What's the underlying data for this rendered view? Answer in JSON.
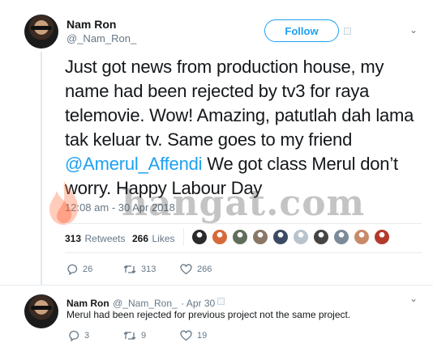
{
  "main_tweet": {
    "name": "Nam Ron",
    "handle": "@_Nam_Ron_",
    "follow_label": "Follow",
    "text_before": "Just got news from production house, my name had been rejected by tv3 for raya telemovie. Wow! Amazing, patutlah dah lama tak keluar tv.  Same goes to my friend ",
    "mention": "@Amerul_Affendi",
    "text_after": " We got class Merul don’t worry. Happy Labour Day",
    "timestamp": "12:08 am - 30 Apr 2018",
    "retweets_count": "313",
    "retweets_label": "Retweets",
    "likes_count": "266",
    "likes_label": "Likes",
    "actions": {
      "replies": "26",
      "retweets": "313",
      "likes": "266"
    }
  },
  "reply_tweet": {
    "name": "Nam Ron",
    "handle": "@_Nam_Ron_",
    "date": "· Apr 30",
    "text": "Merul had been rejected for previous project not the same project.",
    "actions": {
      "replies": "3",
      "retweets": "9",
      "likes": "19"
    }
  },
  "watermark": {
    "text": "hangat.com"
  },
  "colors": {
    "accent": "#1da1f2",
    "muted": "#657786",
    "text": "#14171a",
    "divider": "#e6ecf0"
  },
  "liker_avatar_colors": [
    "#2b2b2b",
    "#d66a3a",
    "#5f6f5a",
    "#8a7766",
    "#3d4a63",
    "#b9c3cc",
    "#454545",
    "#7b8b99",
    "#c98a6a",
    "#b23a2a"
  ]
}
